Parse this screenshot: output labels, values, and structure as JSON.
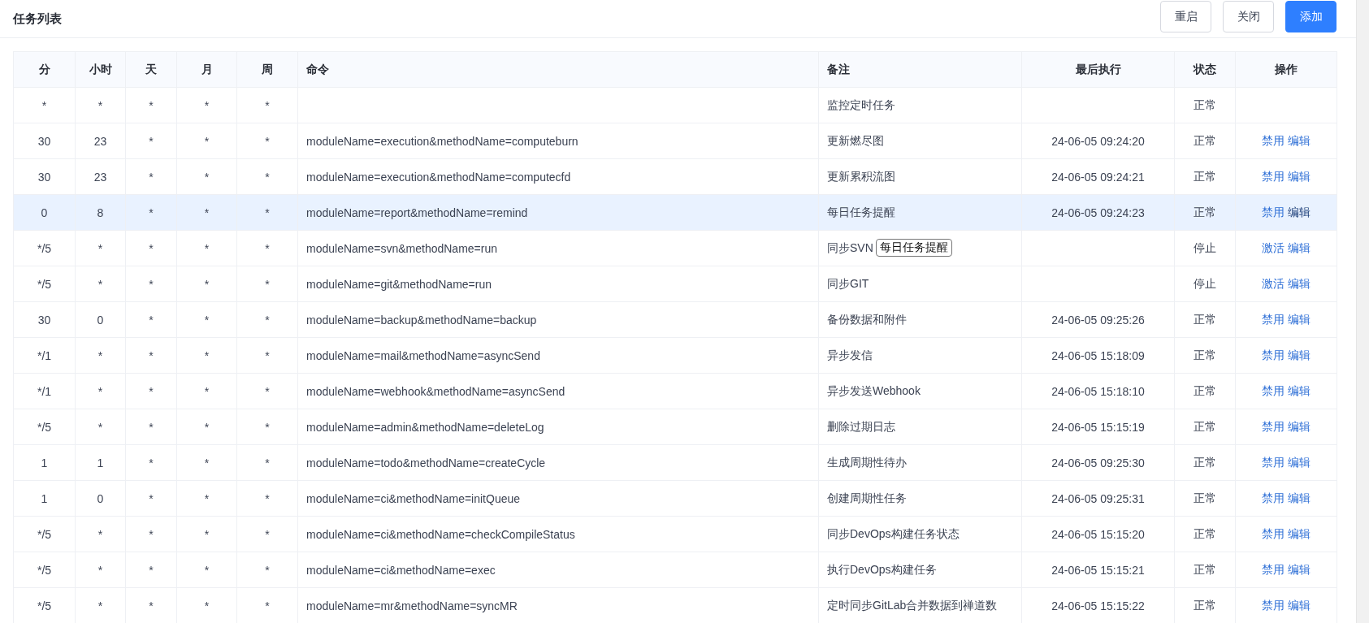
{
  "title": "任务列表",
  "buttons": [
    {
      "label": "重启",
      "kind": "default"
    },
    {
      "label": "关闭",
      "kind": "default"
    },
    {
      "label": "添加",
      "kind": "primary"
    }
  ],
  "columns": [
    "分",
    "小时",
    "天",
    "月",
    "周",
    "命令",
    "备注",
    "最后执行",
    "状态",
    "操作"
  ],
  "rows": [
    {
      "cells": [
        "*",
        "*",
        "*",
        "*",
        "*",
        "",
        "监控定时任务",
        "",
        "正常"
      ],
      "actions": [],
      "selected": false
    },
    {
      "cells": [
        "30",
        "23",
        "*",
        "*",
        "*",
        "moduleName=execution&methodName=computeburn",
        "更新燃尽图",
        "24-06-05 09:24:20",
        "正常"
      ],
      "actions": [
        "禁用",
        "编辑"
      ],
      "selected": false
    },
    {
      "cells": [
        "30",
        "23",
        "*",
        "*",
        "*",
        "moduleName=execution&methodName=computecfd",
        "更新累积流图",
        "24-06-05 09:24:21",
        "正常"
      ],
      "actions": [
        "禁用",
        "编辑"
      ],
      "selected": false
    },
    {
      "cells": [
        "0",
        "8",
        "*",
        "*",
        "*",
        "moduleName=report&methodName=remind",
        "每日任务提醒",
        "24-06-05 09:24:23",
        "正常"
      ],
      "actions": [
        "禁用",
        "编辑"
      ],
      "selected": true
    },
    {
      "cells": [
        "*/5",
        "*",
        "*",
        "*",
        "*",
        "moduleName=svn&methodName=run",
        "同步SVN",
        "",
        "停止"
      ],
      "actions": [
        "激活",
        "编辑"
      ],
      "selected": false,
      "tooltip": "每日任务提醒"
    },
    {
      "cells": [
        "*/5",
        "*",
        "*",
        "*",
        "*",
        "moduleName=git&methodName=run",
        "同步GIT",
        "",
        "停止"
      ],
      "actions": [
        "激活",
        "编辑"
      ],
      "selected": false
    },
    {
      "cells": [
        "30",
        "0",
        "*",
        "*",
        "*",
        "moduleName=backup&methodName=backup",
        "备份数据和附件",
        "24-06-05 09:25:26",
        "正常"
      ],
      "actions": [
        "禁用",
        "编辑"
      ],
      "selected": false
    },
    {
      "cells": [
        "*/1",
        "*",
        "*",
        "*",
        "*",
        "moduleName=mail&methodName=asyncSend",
        "异步发信",
        "24-06-05 15:18:09",
        "正常"
      ],
      "actions": [
        "禁用",
        "编辑"
      ],
      "selected": false
    },
    {
      "cells": [
        "*/1",
        "*",
        "*",
        "*",
        "*",
        "moduleName=webhook&methodName=asyncSend",
        "异步发送Webhook",
        "24-06-05 15:18:10",
        "正常"
      ],
      "actions": [
        "禁用",
        "编辑"
      ],
      "selected": false
    },
    {
      "cells": [
        "*/5",
        "*",
        "*",
        "*",
        "*",
        "moduleName=admin&methodName=deleteLog",
        "删除过期日志",
        "24-06-05 15:15:19",
        "正常"
      ],
      "actions": [
        "禁用",
        "编辑"
      ],
      "selected": false
    },
    {
      "cells": [
        "1",
        "1",
        "*",
        "*",
        "*",
        "moduleName=todo&methodName=createCycle",
        "生成周期性待办",
        "24-06-05 09:25:30",
        "正常"
      ],
      "actions": [
        "禁用",
        "编辑"
      ],
      "selected": false
    },
    {
      "cells": [
        "1",
        "0",
        "*",
        "*",
        "*",
        "moduleName=ci&methodName=initQueue",
        "创建周期性任务",
        "24-06-05 09:25:31",
        "正常"
      ],
      "actions": [
        "禁用",
        "编辑"
      ],
      "selected": false
    },
    {
      "cells": [
        "*/5",
        "*",
        "*",
        "*",
        "*",
        "moduleName=ci&methodName=checkCompileStatus",
        "同步DevOps构建任务状态",
        "24-06-05 15:15:20",
        "正常"
      ],
      "actions": [
        "禁用",
        "编辑"
      ],
      "selected": false
    },
    {
      "cells": [
        "*/5",
        "*",
        "*",
        "*",
        "*",
        "moduleName=ci&methodName=exec",
        "执行DevOps构建任务",
        "24-06-05 15:15:21",
        "正常"
      ],
      "actions": [
        "禁用",
        "编辑"
      ],
      "selected": false
    },
    {
      "cells": [
        "*/5",
        "*",
        "*",
        "*",
        "*",
        "moduleName=mr&methodName=syncMR",
        "定时同步GitLab合并数据到禅道数",
        "24-06-05 15:15:22",
        "正常"
      ],
      "actions": [
        "禁用",
        "编辑"
      ],
      "selected": false
    }
  ]
}
